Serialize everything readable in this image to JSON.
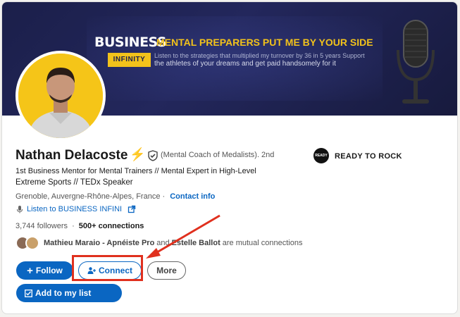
{
  "banner": {
    "brand": "BUSINESS",
    "tag": "INFINITY",
    "headline": "MENTAL PREPARERS PUT ME BY YOUR SIDE",
    "line1": "Listen to the strategies that multiplied my turnover by 36 in 5 years Support",
    "line2": "the athletes of your dreams and get paid handsomely for it"
  },
  "profile": {
    "name": "Nathan Delacoste",
    "bolt": "⚡",
    "degree": "(Mental Coach of Medalists). 2nd",
    "headline_line1": "1st Business Mentor for Mental Trainers // Mental Expert in High-Level",
    "headline_line2": "Extreme Sports // TEDx Speaker",
    "location": "Grenoble, Auvergne-Rhône-Alpes, France ·",
    "contact_info": "Contact info",
    "listen_link": "Listen to BUSINESS INFINI",
    "followers": "3,744 followers",
    "separator": "·",
    "connections": "500+ connections"
  },
  "company": {
    "logo_text": "READY TO ROCK",
    "name": "READY TO ROCK"
  },
  "mutual": {
    "name1": "Mathieu Maraio - Apnéiste Pro",
    "and_text": "and",
    "name2": "Estelle Ballot",
    "suffix": "are mutual connections"
  },
  "actions": {
    "follow": "Follow",
    "connect": "Connect",
    "more": "More",
    "add_list": "Add to my list"
  },
  "colors": {
    "linkedin_blue": "#0a66c2",
    "banner_yellow": "#f2c21b",
    "highlight_red": "#e0301e"
  }
}
